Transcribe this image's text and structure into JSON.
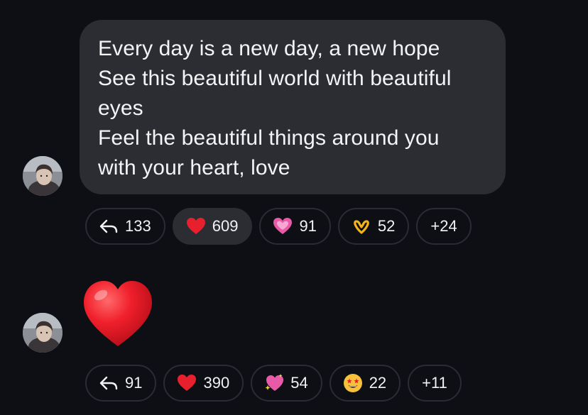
{
  "message1": {
    "lines": [
      "Every day is a new day, a new hope",
      "See this beautiful world with beautiful",
      "eyes",
      "Feel the beautiful things around you",
      "with your heart, love"
    ],
    "reactions": {
      "reply": "133",
      "red_heart": "609",
      "sparkling_heart": "91",
      "heart_hands": "52",
      "more": "+24"
    }
  },
  "message2": {
    "emoji": "red-heart",
    "reactions": {
      "reply": "91",
      "red_heart": "390",
      "sparkle_heart": "54",
      "star_struck": "22",
      "more": "+11"
    }
  },
  "colors": {
    "background": "#0d0f14",
    "bubble": "#2c2d33",
    "chip_border": "#2a2c33",
    "heart_red": "#e8202e",
    "pink_heart": "#e85aa8"
  }
}
